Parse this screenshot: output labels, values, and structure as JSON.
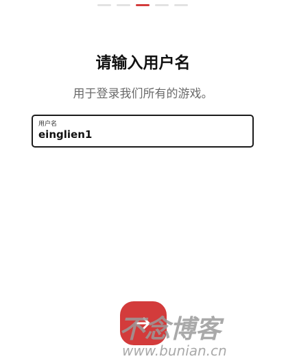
{
  "progress": {
    "total_steps": 5,
    "current_step": 3
  },
  "header": {
    "title": "请输入用户名",
    "subtitle": "用于登录我们所有的游戏。"
  },
  "username_field": {
    "label": "用户名",
    "value": "einglien1"
  },
  "next_button": {
    "icon": "arrow-right-icon"
  },
  "watermark": {
    "brand": "不念博客",
    "url": "www.bunian.cn"
  },
  "colors": {
    "accent": "#d33b3b",
    "text": "#111111",
    "subtitle": "#6a6a6a",
    "step_inactive": "#e2e2e2"
  }
}
